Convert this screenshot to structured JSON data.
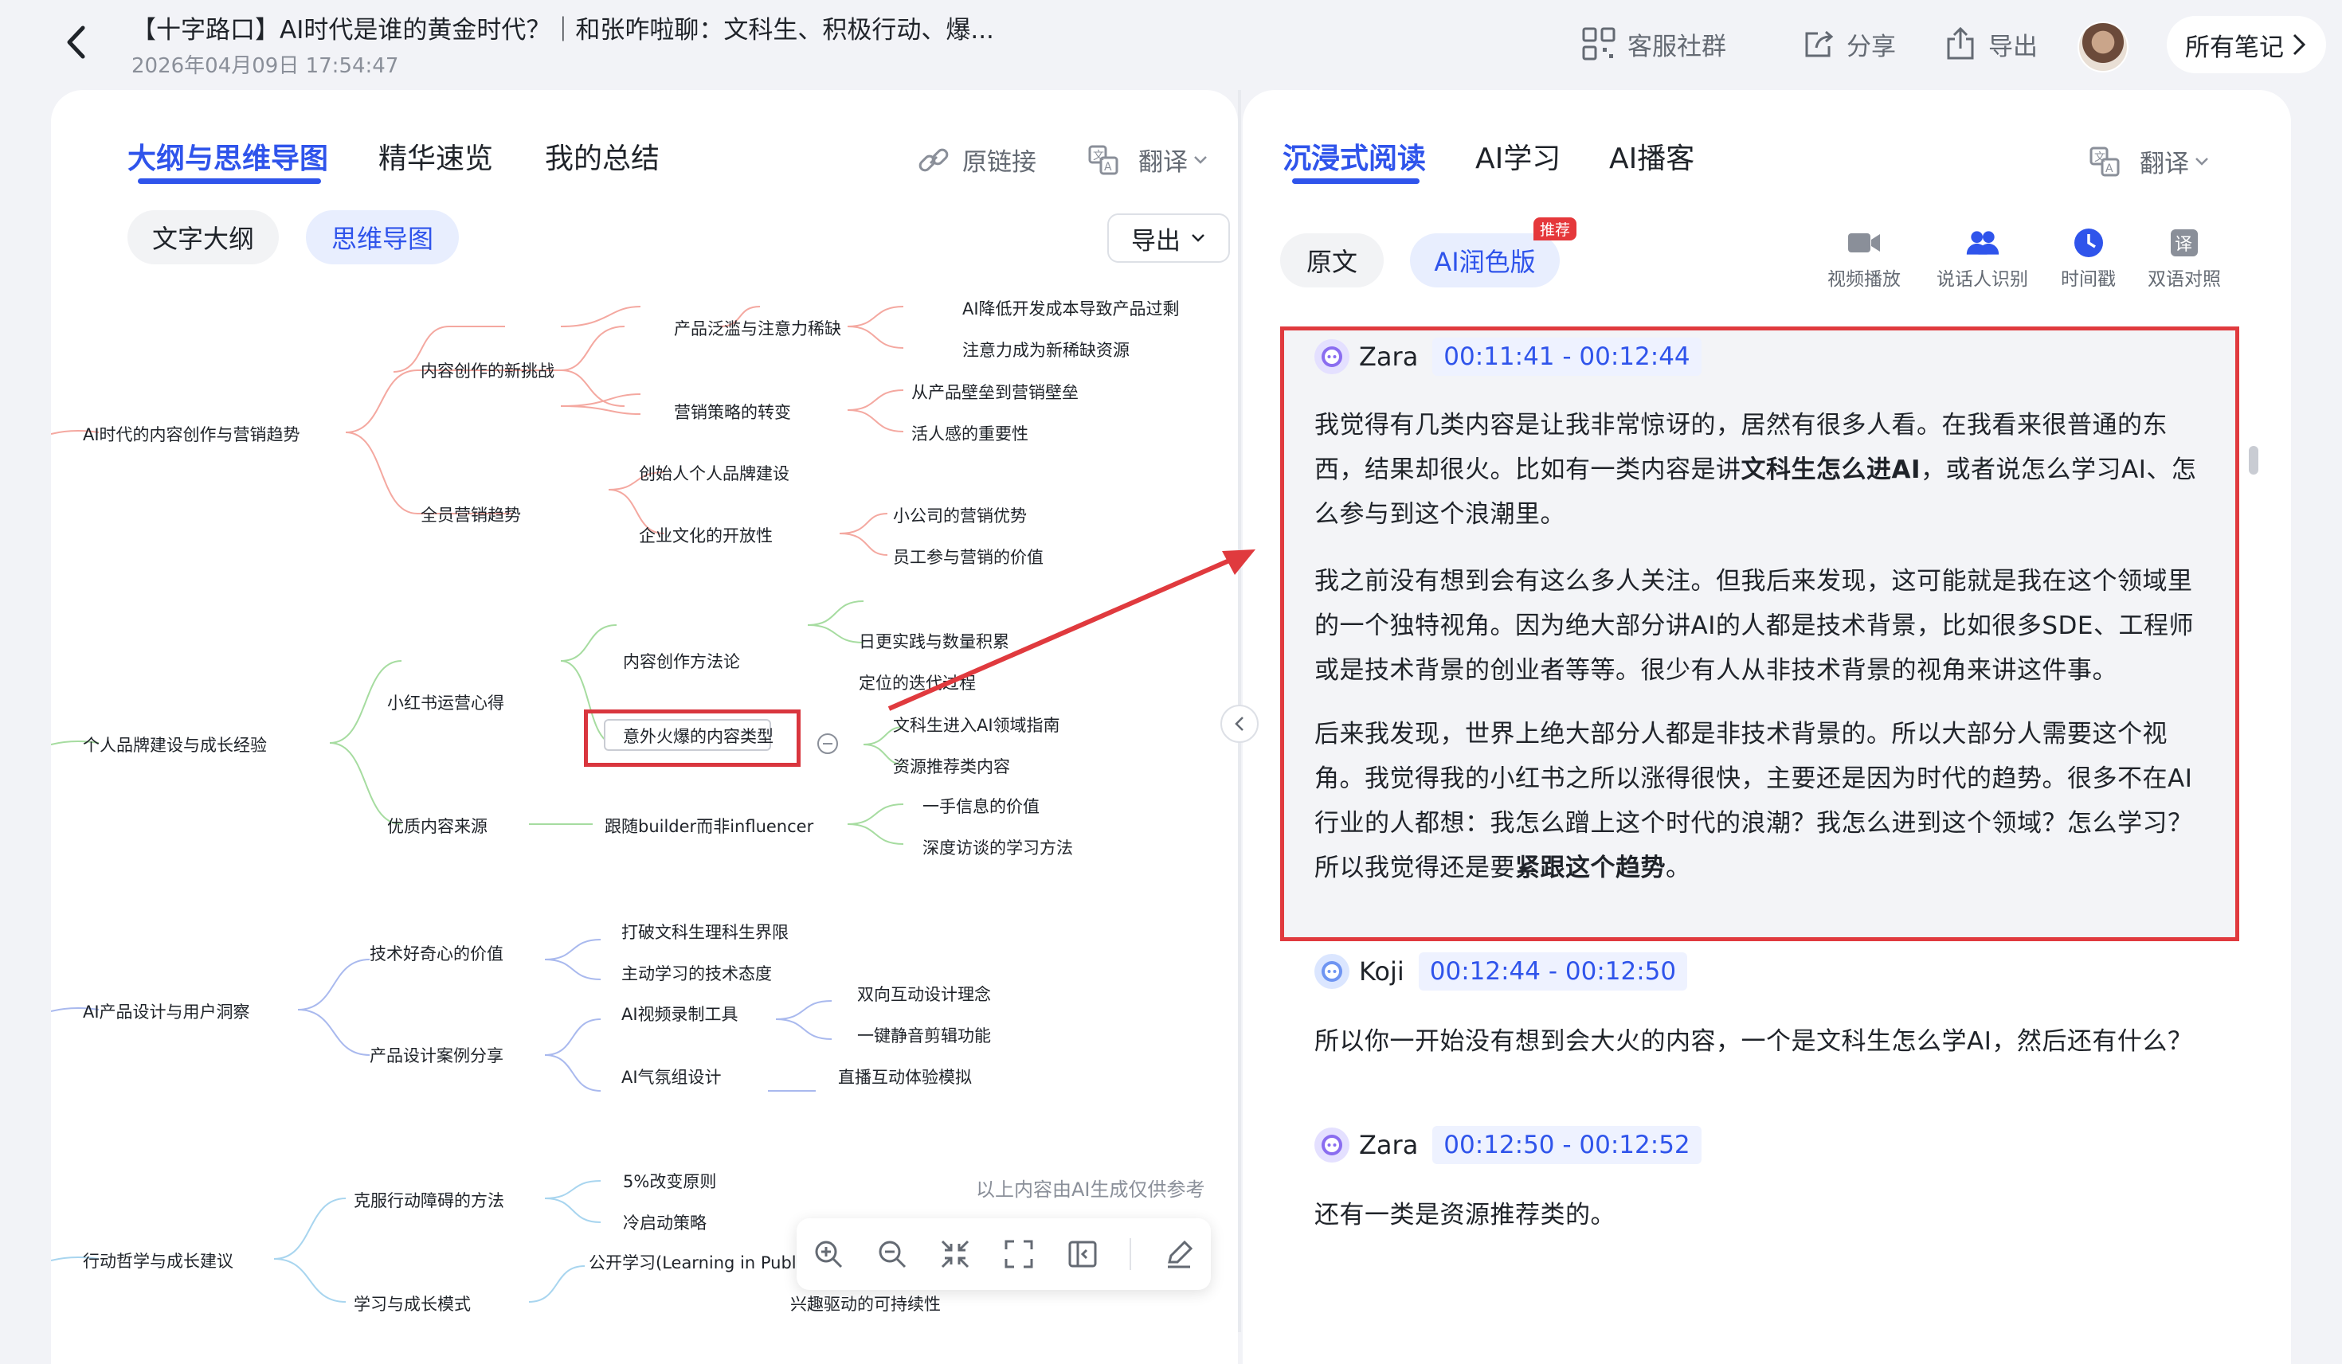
{
  "header": {
    "title": "【十字路口】AI时代是谁的黄金时代？｜和张咋啦聊：文科生、积极行动、爆...",
    "date": "2026年04月09日 17:54:47",
    "actions": {
      "community": "客服社群",
      "share": "分享",
      "export": "导出"
    },
    "all_notes": "所有笔记"
  },
  "left": {
    "tabs": [
      "大纲与思维导图",
      "精华速览",
      "我的总结"
    ],
    "original_link": "原链接",
    "translate": "翻译",
    "view_modes": [
      "文字大纲",
      "思维导图"
    ],
    "export": "导出",
    "ai_note": "以上内容由AI生成仅供参考",
    "mindmap": {
      "n1": "AI时代的内容创作与营销趋势",
      "n1a": "内容创作的新挑战",
      "n1a1": "产品泛滥与注意力稀缺",
      "n1a1a": "AI降低开发成本导致产品过剩",
      "n1a1b": "注意力成为新稀缺资源",
      "n1a2": "营销策略的转变",
      "n1a2a": "从产品壁垒到营销壁垒",
      "n1a2b": "活人感的重要性",
      "n1b": "全员营销趋势",
      "n1b1": "创始人个人品牌建设",
      "n1b2": "企业文化的开放性",
      "n1b2a": "小公司的营销优势",
      "n1b2b": "员工参与营销的价值",
      "n2": "个人品牌建设与成长经验",
      "n2a": "小红书运营心得",
      "n2a1": "内容创作方法论",
      "n2a1a": "日更实践与数量积累",
      "n2a1b": "定位的迭代过程",
      "n2a2": "意外火爆的内容类型",
      "n2a2a": "文科生进入AI领域指南",
      "n2a2b": "资源推荐类内容",
      "n2b": "优质内容来源",
      "n2b1": "跟随builder而非influencer",
      "n2b1a": "一手信息的价值",
      "n2b1b": "深度访谈的学习方法",
      "n3": "AI产品设计与用户洞察",
      "n3a": "技术好奇心的价值",
      "n3a1": "打破文科生理科生界限",
      "n3a2": "主动学习的技术态度",
      "n3b": "产品设计案例分享",
      "n3b1": "AI视频录制工具",
      "n3b1a": "双向互动设计理念",
      "n3b1b": "一键静音剪辑功能",
      "n3b2": "AI气氛组设计",
      "n3b2a": "直播互动体验模拟",
      "n4": "行动哲学与成长建议",
      "n4a": "克服行动障碍的方法",
      "n4a1": "5%改变原则",
      "n4a2": "冷启动策略",
      "n4b": "学习与成长模式",
      "n4b1": "公开学习(Learning in Public)的价值",
      "n4b2": "兴趣驱动的可持续性"
    }
  },
  "right": {
    "tabs": [
      "沉浸式阅读",
      "AI学习",
      "AI播客"
    ],
    "translate": "翻译",
    "modes": [
      "原文",
      "AI润色版"
    ],
    "badge": "推荐",
    "tools": [
      "视频播放",
      "说话人识别",
      "时间戳",
      "双语对照"
    ],
    "blocks": [
      {
        "speaker": "Zara",
        "time": "00:11:41 - 00:12:44",
        "paras": [
          [
            "我觉得有几类内容是让我非常惊讶的，居然有很多人看。在我看来很普通的东西，结果却很火。比如有一类内容是讲",
            "文科生怎么进AI",
            "，或者说怎么学习AI、怎么参与到这个浪潮里。"
          ],
          [
            "我之前没有想到会有这么多人关注。但我后来发现，这可能就是我在这个领域里的一个独特视角。因为绝大部分讲AI的人都是技术背景，比如很多SDE、工程师或是技术背景的创业者等等。很少有人从非技术背景的视角来讲这件事。",
            "",
            ""
          ],
          [
            "后来我发现，世界上绝大部分人都是非技术背景的。所以大部分人需要这个视角。我觉得我的小红书之所以涨得很快，主要还是因为时代的趋势。很多不在AI行业的人都想：我怎么蹭上这个时代的浪潮？我怎么进到这个领域？怎么学习？所以我觉得还是要",
            "紧跟这个趋势",
            "。"
          ]
        ]
      },
      {
        "speaker": "Koji",
        "time": "00:12:44 - 00:12:50",
        "text": "所以你一开始没有想到会大火的内容，一个是文科生怎么学AI，然后还有什么？"
      },
      {
        "speaker": "Zara",
        "time": "00:12:50 - 00:12:52",
        "text": "还有一类是资源推荐类的。"
      }
    ]
  },
  "colors": {
    "accent": "#2f54eb",
    "highlight": "#e03a3e",
    "branch1": "#f4a8a0",
    "branch2": "#a6dca0",
    "branch3": "#a9b9ee",
    "branch4": "#a8d5ef"
  }
}
